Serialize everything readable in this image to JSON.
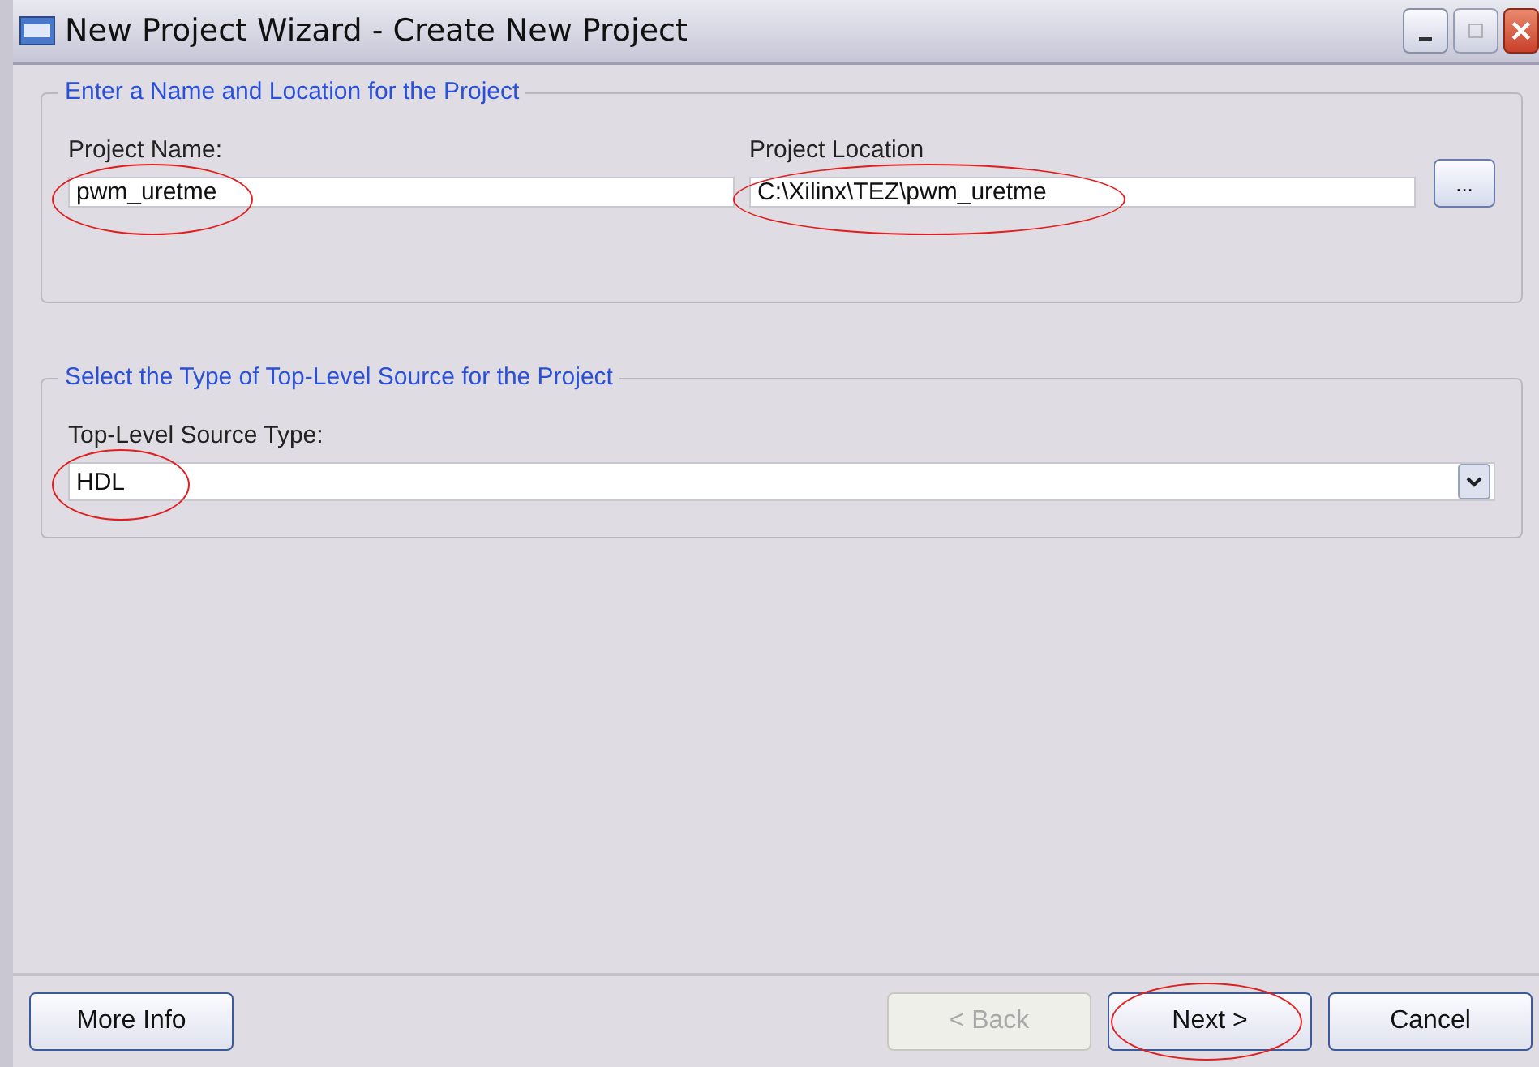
{
  "window": {
    "title": "New Project Wizard - Create New Project"
  },
  "groups": [
    {
      "title": "Enter a Name and Location for the Project",
      "kind": "paths",
      "fields": [
        {
          "label": "Project Name:",
          "value": "pwm_uretme",
          "circled": true
        },
        {
          "label": "Project Location",
          "value": "C:\\Xilinx\\TEZ\\pwm_uretme",
          "circled": true
        }
      ],
      "browse": "..."
    },
    {
      "title": "Select the Type of Top-Level Source for the Project",
      "kind": "dropdown",
      "fields": [
        {
          "label": "Top-Level Source Type:",
          "value": "HDL",
          "circled": true
        }
      ]
    }
  ],
  "buttons": [
    {
      "label": "More Info",
      "disabled": false,
      "circled": false
    },
    {
      "label": "< Back",
      "disabled": true,
      "circled": false
    },
    {
      "label": "Next >",
      "disabled": false,
      "circled": true
    },
    {
      "label": "Cancel",
      "disabled": false,
      "circled": false
    }
  ]
}
